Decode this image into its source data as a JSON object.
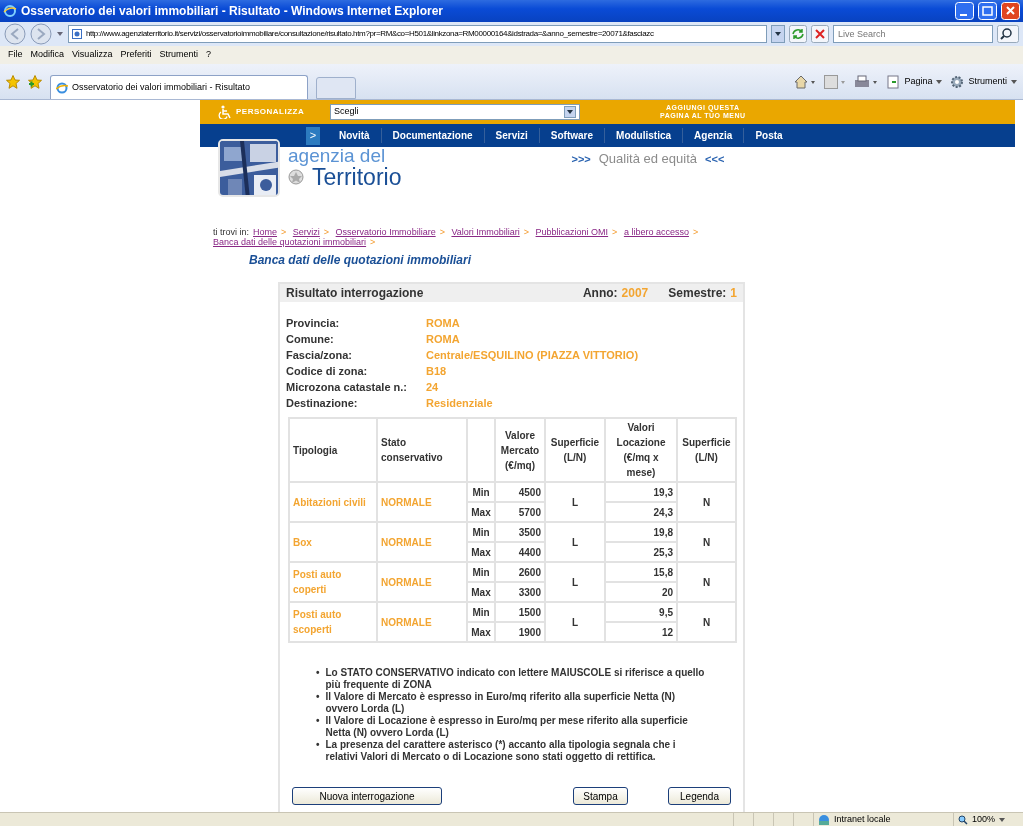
{
  "window": {
    "title": "Osservatorio dei valori immobiliari - Risultato - Windows Internet Explorer"
  },
  "address_bar": {
    "url": "http://www.agenziaterritorio.it/servizi/osservatorioimmobiliare/consultazione/risultato.htm?pr=RM&co=H501&linkzona=RM00000164&idstrada=&anno_semestre=20071&fasciazc",
    "search_placeholder": "Live Search"
  },
  "menu": [
    "File",
    "Modifica",
    "Visualizza",
    "Preferiti",
    "Strumenti",
    "?"
  ],
  "tabs": [
    {
      "label": "Osservatorio dei valori immobiliari - Risultato",
      "selected": true
    }
  ],
  "command_bar": [
    "Pagina",
    "Strumenti"
  ],
  "site": {
    "personalizza": "PERSONALIZZA",
    "select_value": "Scegli",
    "add_menu": [
      "AGGIUNGI QUESTA",
      "PAGINA AL TUO MENU"
    ],
    "nav_marker": ">",
    "nav": [
      "Novità",
      "Documentazione",
      "Servizi",
      "Software",
      "Modulistica",
      "Agenzia",
      "Posta"
    ],
    "logo_top": "agenzia del",
    "logo_bottom": "Territorio",
    "tagline_left": ">>>",
    "tagline": "Qualità ed equità",
    "tagline_right": "<<<"
  },
  "breadcrumb": {
    "label": "ti trovi in:",
    "separator": ">",
    "links": [
      "Home",
      "Servizi",
      "Osservatorio Immobiliare",
      "Valori Immobiliari",
      "Pubblicazioni OMI",
      "a libero accesso",
      "Banca dati delle quotazioni immobiliari"
    ]
  },
  "heading": "Banca dati delle quotazioni immobiliari",
  "result": {
    "title": "Risultato interrogazione",
    "anno_label": "Anno:",
    "anno": "2007",
    "semestre_label": "Semestre:",
    "semestre": "1",
    "fields": [
      {
        "label": "Provincia:",
        "value": "ROMA"
      },
      {
        "label": "Comune:",
        "value": "ROMA"
      },
      {
        "label": "Fascia/zona:",
        "value": "Centrale/ESQUILINO (PIAZZA VITTORIO)"
      },
      {
        "label": "Codice di zona:",
        "value": "B18"
      },
      {
        "label": "Microzona catastale n.:",
        "value": "24"
      },
      {
        "label": "Destinazione:",
        "value": "Residenziale"
      }
    ],
    "columns": [
      "Tipologia",
      "Stato conservativo",
      "Valore Mercato (€/mq)",
      "Superficie (L/N)",
      "Valori Locazione (€/mq x mese)",
      "Superficie (L/N)"
    ],
    "rows": [
      {
        "tipologia": "Abitazioni civili",
        "stato": "NORMALE",
        "min": {
          "label": "Min",
          "mercato": "4500",
          "locazione": "19,3"
        },
        "max": {
          "label": "Max",
          "mercato": "5700",
          "locazione": "24,3"
        },
        "superficie_mercato": "L",
        "superficie_locazione": "N"
      },
      {
        "tipologia": "Box",
        "stato": "NORMALE",
        "min": {
          "label": "Min",
          "mercato": "3500",
          "locazione": "19,8"
        },
        "max": {
          "label": "Max",
          "mercato": "4400",
          "locazione": "25,3"
        },
        "superficie_mercato": "L",
        "superficie_locazione": "N"
      },
      {
        "tipologia": "Posti auto coperti",
        "stato": "NORMALE",
        "min": {
          "label": "Min",
          "mercato": "2600",
          "locazione": "15,8"
        },
        "max": {
          "label": "Max",
          "mercato": "3300",
          "locazione": "20"
        },
        "superficie_mercato": "L",
        "superficie_locazione": "N"
      },
      {
        "tipologia": "Posti auto scoperti",
        "stato": "NORMALE",
        "min": {
          "label": "Min",
          "mercato": "1500",
          "locazione": "9,5"
        },
        "max": {
          "label": "Max",
          "mercato": "1900",
          "locazione": "12"
        },
        "superficie_mercato": "L",
        "superficie_locazione": "N"
      }
    ],
    "note_bullet": "•",
    "notes": [
      "Lo STATO CONSERVATIVO indicato con lettere MAIUSCOLE si riferisce a quello più frequente di ZONA",
      "Il Valore di Mercato è espresso in Euro/mq riferito alla superficie Netta (N) ovvero Lorda (L)",
      "Il Valore di Locazione è espresso in Euro/mq per mese riferito alla superficie Netta (N) ovvero Lorda (L)",
      "La presenza del carattere asterisco (*) accanto alla tipologia segnala che i relativi Valori di Mercato o di Locazione sono stati oggetto di rettifica."
    ],
    "buttons": {
      "new_query": "Nuova interrogazione",
      "print": "Stampa",
      "legend": "Legenda"
    }
  },
  "status_bar": {
    "zone": "Intranet locale",
    "zoom": "100%"
  }
}
